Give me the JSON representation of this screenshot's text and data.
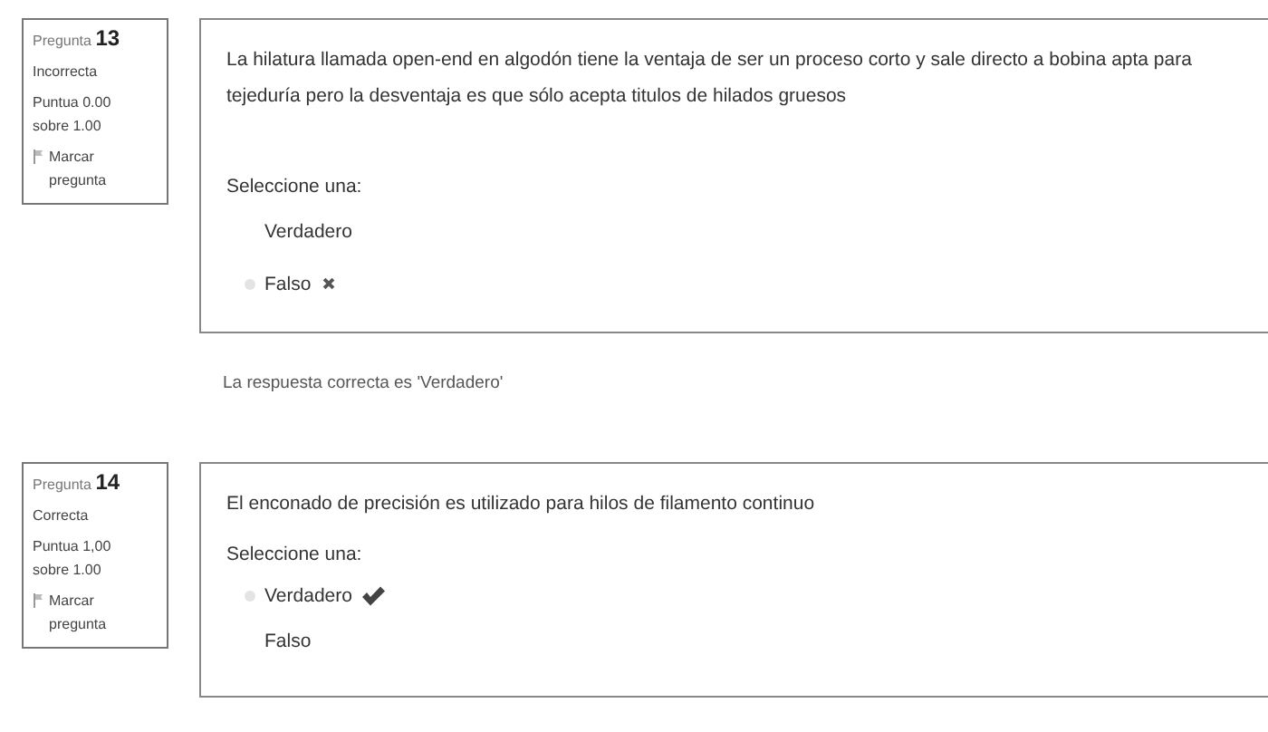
{
  "questions": [
    {
      "label": "Pregunta",
      "number": "13",
      "status": "Incorrecta",
      "score": "Puntua 0.00 sobre 1.00",
      "flag": "Marcar pregunta",
      "text": "La hilatura llamada open-end en algodón tiene la ventaja de ser un proceso corto y sale directo a bobina apta para tejeduría pero la desventaja es que sólo acepta titulos de hilados gruesos",
      "prompt": "Seleccione una:",
      "options": [
        {
          "label": "Verdadero",
          "selected": false,
          "marked_correct": false,
          "marked_incorrect": false
        },
        {
          "label": "Falso",
          "selected": true,
          "marked_correct": false,
          "marked_incorrect": true
        }
      ],
      "feedback": "La respuesta correcta es 'Verdadero'"
    },
    {
      "label": "Pregunta",
      "number": "14",
      "status": "Correcta",
      "score": "Puntua 1,00 sobre 1.00",
      "flag": "Marcar pregunta",
      "text": "El enconado de precisión es utilizado para hilos de filamento continuo",
      "prompt": "Seleccione una:",
      "options": [
        {
          "label": "Verdadero",
          "selected": true,
          "marked_correct": true,
          "marked_incorrect": false
        },
        {
          "label": "Falso",
          "selected": false,
          "marked_correct": false,
          "marked_incorrect": false
        }
      ]
    }
  ]
}
